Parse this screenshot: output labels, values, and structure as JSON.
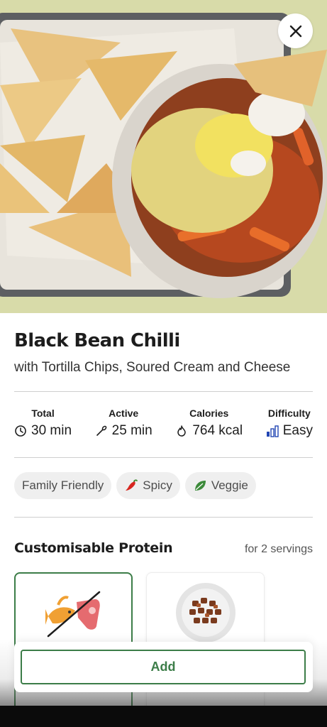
{
  "hero": {
    "image": "black-bean-chilli-photo",
    "close_icon": "close-icon"
  },
  "recipe": {
    "title": "Black Bean Chilli",
    "subtitle": "with Tortilla Chips, Soured Cream and Cheese"
  },
  "stats": [
    {
      "label": "Total",
      "value": "30 min",
      "icon": "clock-icon"
    },
    {
      "label": "Active",
      "value": "25 min",
      "icon": "utensil-icon"
    },
    {
      "label": "Calories",
      "value": "764 kcal",
      "icon": "flame-icon"
    },
    {
      "label": "Difficulty",
      "value": "Easy",
      "icon": "difficulty-bars-icon"
    }
  ],
  "tags": [
    {
      "label": "Family Friendly",
      "icon": ""
    },
    {
      "label": "Spicy",
      "icon": "chili-pepper-icon"
    },
    {
      "label": "Veggie",
      "icon": "leaf-icon"
    }
  ],
  "protein": {
    "title": "Customisable Protein",
    "servings": "for 2 servings",
    "cards": [
      {
        "icon": "no-meat-fish-icon",
        "selected": true
      },
      {
        "icon": "meat-chunks-bowl-icon",
        "selected": false
      }
    ]
  },
  "actions": {
    "add_label": "Add"
  },
  "colors": {
    "accent": "#3c7d48",
    "divider": "#cfcfcf",
    "tag_bg": "#efefef"
  }
}
